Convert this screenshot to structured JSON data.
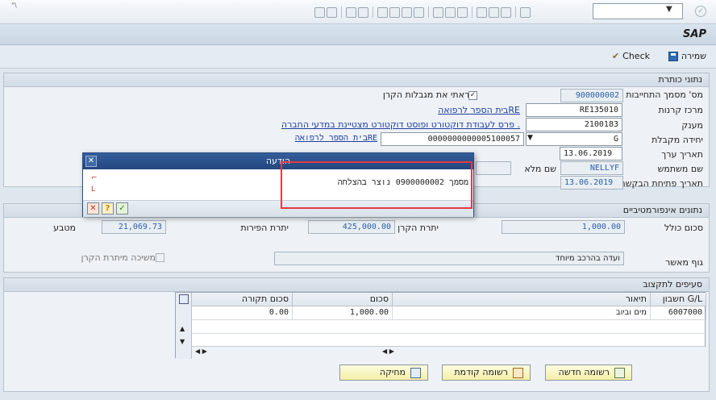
{
  "toolbar": {
    "corner_mark": "°\\"
  },
  "title": "SAP",
  "app_toolbar": {
    "save": "שמירה",
    "check": "Check"
  },
  "header_group": {
    "title": "נתוני כותרת",
    "fields": {
      "commit_doc_label": "מס' מסמך התחייבות",
      "commit_doc_value": "900000002",
      "read_limits_label": "קראתי את מגבלות הקרן",
      "fund_center_label": "מרכז קרנות",
      "fund_center_value": "RE135010",
      "fund_center_link": "בית הספר לרפואהRE",
      "grant_label": "מענק",
      "grant_value": "2100183",
      "grant_link": "פרס לעבודת דוקטורט ופוסט דוקטורט מצטיינת במדעי החברה .",
      "receiving_unit_label": "יחידה מקבלת",
      "receiving_unit_value": "G",
      "receiving_unit_code": "0000000000005100057",
      "receiving_unit_link": "בית הספר לרפואהRE",
      "value_date_label": "תאריך ערך",
      "value_date": "13.06.2019",
      "username_label": "שם משתמש",
      "username_value": "NELLYF",
      "fullname_label": "שם מלא",
      "request_date_label": "תאריך פתיחת הבקשה",
      "request_date": "13.06.2019"
    }
  },
  "dialog": {
    "title": "הודעה",
    "message": "מסמך 0900000002 נוצר בהצלחה"
  },
  "info_group": {
    "title": "נתונים אינפורמטיביים",
    "total_label": "סכום כולל",
    "total_value": "1,000.00",
    "fund_balance_label": "יתרת הקרן",
    "fund_balance_value": "425,000.00",
    "fruits_balance_label": "יתרת הפירות",
    "fruits_balance_value": "21,069.73",
    "currency_label": "מטבע",
    "approver_label": "גוף מאשר",
    "approver_value": "ועדה בהרכב מיוחד",
    "withdraw_label": "משיכה מיתרת הקרן"
  },
  "lines_group": {
    "title": "סעיפים לתקצוב",
    "columns": [
      "חשבון G/L",
      "תיאור",
      "סכום",
      "סכום תקורה"
    ],
    "rows": [
      {
        "gl": "6007000",
        "desc": "מים וביוב",
        "amount": "1,000.00",
        "overhead": "0.00"
      }
    ]
  },
  "buttons": {
    "new_record": "רשומה חדשה",
    "prev_record": "רשומה קודמת",
    "delete": "מחיקה"
  }
}
